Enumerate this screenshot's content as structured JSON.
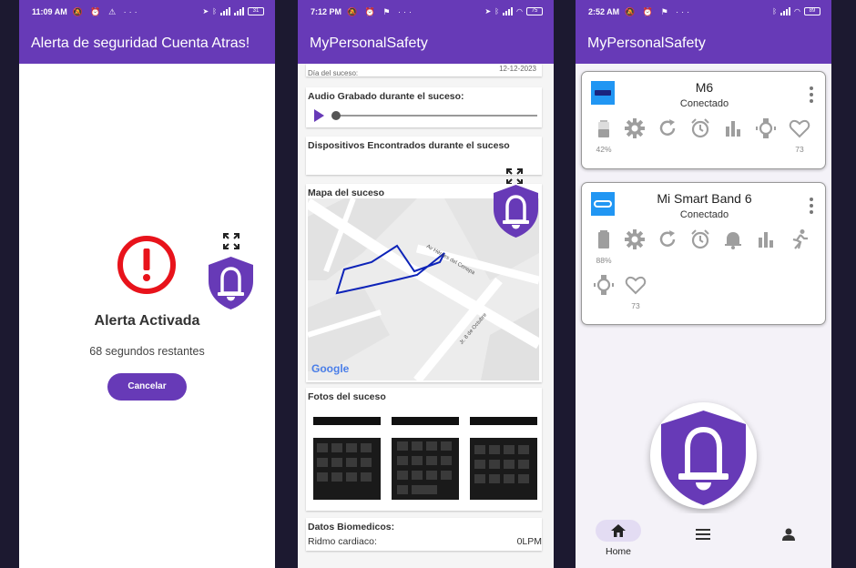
{
  "phone1": {
    "status": {
      "time": "11:09 AM",
      "icons": "🔕 ⏰ ⚠ ···",
      "battery": "31"
    },
    "appbar_title": "Alerta de seguridad Cuenta Atras!",
    "alert_title": "Alerta Activada",
    "alert_subtitle": "68 segundos restantes",
    "cancel_label": "Cancelar"
  },
  "phone2": {
    "status": {
      "time": "7:12 PM",
      "icons": "🔕 ⏰ ⚑ ···",
      "battery": "75"
    },
    "appbar_title": "MyPersonalSafety",
    "top_strip_left": "Día del suceso:",
    "top_strip_right": "12-12-2023",
    "audio_label": "Audio Grabado durante el suceso:",
    "devices_label": "Dispositivos Encontrados durante el suceso",
    "map_label": "Mapa del suceso",
    "map_street_1": "Av Héroes del Cenepa",
    "map_street_2": "Jr. 8 de Octubre",
    "map_provider": "Google",
    "photos_label": "Fotos del suceso",
    "bio_label": "Datos Biomedicos:",
    "bio_row_label": "Ridmo cardiaco:",
    "bio_row_value": "0LPM"
  },
  "phone3": {
    "status": {
      "time": "2:52 AM",
      "icons": "🔕 ⏰ ⚑ ···",
      "battery": "89"
    },
    "appbar_title": "MyPersonalSafety",
    "devices": [
      {
        "name": "M6",
        "status": "Conectado",
        "battery": "42%",
        "heart": "73"
      },
      {
        "name": "Mi Smart Band 6",
        "status": "Conectado",
        "battery": "88%",
        "heart": "73"
      }
    ],
    "nav": {
      "home_label": "Home"
    }
  },
  "colors": {
    "primary": "#673ab7",
    "warn_red": "#e8131b",
    "device_blue": "#2196f3",
    "icon_gray": "#9e9e9e"
  }
}
